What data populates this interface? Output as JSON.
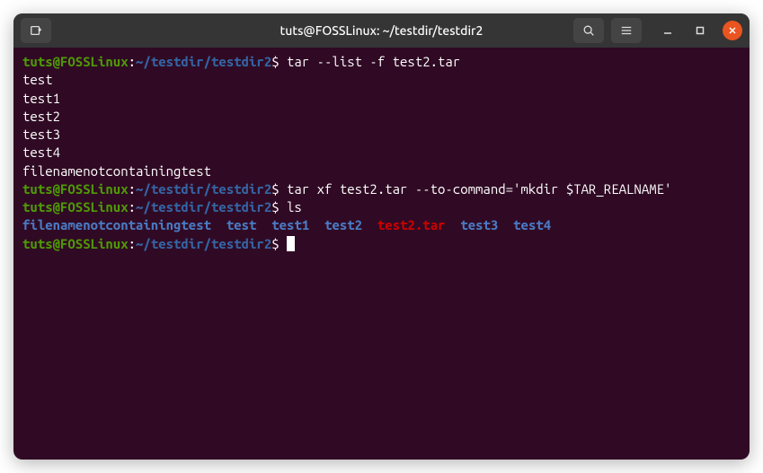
{
  "window": {
    "title": "tuts@FOSSLinux: ~/testdir/testdir2"
  },
  "prompt": {
    "user_host": "tuts@FOSSLinux",
    "separator": ":",
    "path": "~/testdir/testdir2",
    "symbol": "$"
  },
  "lines": {
    "cmd1": " tar --list -f test2.tar",
    "out1": "test",
    "out2": "test1",
    "out3": "test2",
    "out4": "test3",
    "out5": "test4",
    "out6": "filenamenotcontainingtest",
    "cmd2": " tar xf test2.tar --to-command='mkdir $TAR_REALNAME'",
    "cmd3": " ls",
    "ls": {
      "item1": "filenamenotcontainingtest",
      "item2": "test",
      "item3": "test1",
      "item4": "test2",
      "item5": "test2.tar",
      "item6": "test3",
      "item7": "test4"
    }
  }
}
